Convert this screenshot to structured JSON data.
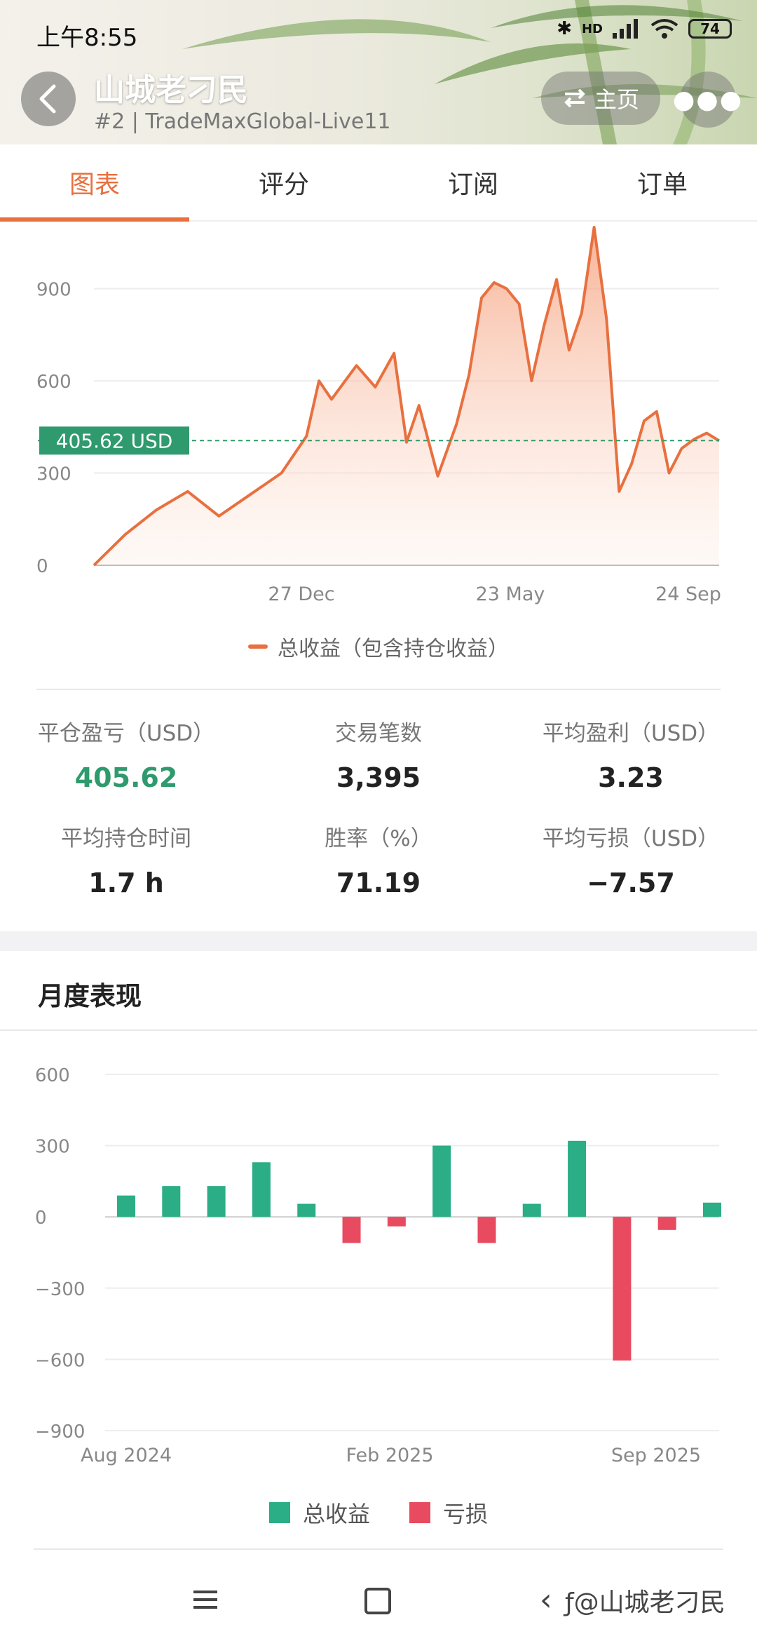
{
  "status_bar": {
    "time": "上午8:55",
    "network": "HD",
    "battery": "74"
  },
  "header": {
    "title": "山城老刁民",
    "subtitle": "#2 | TradeMaxGlobal-Live11",
    "home_button": "主页"
  },
  "tabs": [
    {
      "label": "图表",
      "active": true
    },
    {
      "label": "评分",
      "active": false
    },
    {
      "label": "订阅",
      "active": false
    },
    {
      "label": "订单",
      "active": false
    }
  ],
  "equity_chart": {
    "current_label": "405.62 USD",
    "legend": "总收益（包含持仓收益）"
  },
  "stats": [
    {
      "label": "平仓盈亏（USD）",
      "value": "405.62",
      "color": "green"
    },
    {
      "label": "交易笔数",
      "value": "3,395"
    },
    {
      "label": "平均盈利（USD）",
      "value": "3.23"
    },
    {
      "label": "平均持仓时间",
      "value": "1.7 h"
    },
    {
      "label": "胜率（%）",
      "value": "71.19"
    },
    {
      "label": "平均亏损（USD）",
      "value": "−7.57"
    }
  ],
  "monthly": {
    "title": "月度表现"
  },
  "chart_data": [
    {
      "type": "area",
      "ylim": [
        0,
        1100
      ],
      "y_ticks": [
        0,
        300,
        600,
        900
      ],
      "x_tick_labels": [
        "27 Dec",
        "23 May",
        "24 Sep"
      ],
      "current_value": 405.62,
      "legend": [
        "总收益（包含持仓收益）"
      ],
      "colors": {
        "line": "#e8703f",
        "label_bg": "#2f9a6d"
      },
      "series": [
        {
          "name": "总收益（包含持仓收益）",
          "x": [
            0,
            5,
            10,
            15,
            20,
            25,
            30,
            34,
            36,
            38,
            42,
            45,
            48,
            50,
            52,
            55,
            58,
            60,
            62,
            64,
            66,
            68,
            70,
            72,
            74,
            76,
            78,
            80,
            82,
            84,
            86,
            88,
            90,
            92,
            94,
            96,
            98,
            100
          ],
          "values": [
            0,
            100,
            180,
            240,
            160,
            230,
            300,
            420,
            600,
            540,
            650,
            580,
            690,
            400,
            520,
            290,
            460,
            620,
            870,
            920,
            900,
            850,
            600,
            780,
            930,
            700,
            820,
            1100,
            800,
            240,
            330,
            470,
            500,
            300,
            380,
            410,
            430,
            405
          ]
        }
      ]
    },
    {
      "type": "bar",
      "ylim": [
        -900,
        600
      ],
      "y_ticks": [
        600,
        300,
        0,
        -300,
        -600,
        -900
      ],
      "x_tick_labels": [
        "Aug 2024",
        "Feb 2025",
        "Sep 2025"
      ],
      "legend": [
        "总收益",
        "亏损"
      ],
      "colors": {
        "gain": "#2bad86",
        "loss": "#e84a5f"
      },
      "values": [
        90,
        130,
        130,
        230,
        55,
        -110,
        -40,
        300,
        -110,
        55,
        320,
        -605,
        -55,
        60
      ]
    }
  ]
}
